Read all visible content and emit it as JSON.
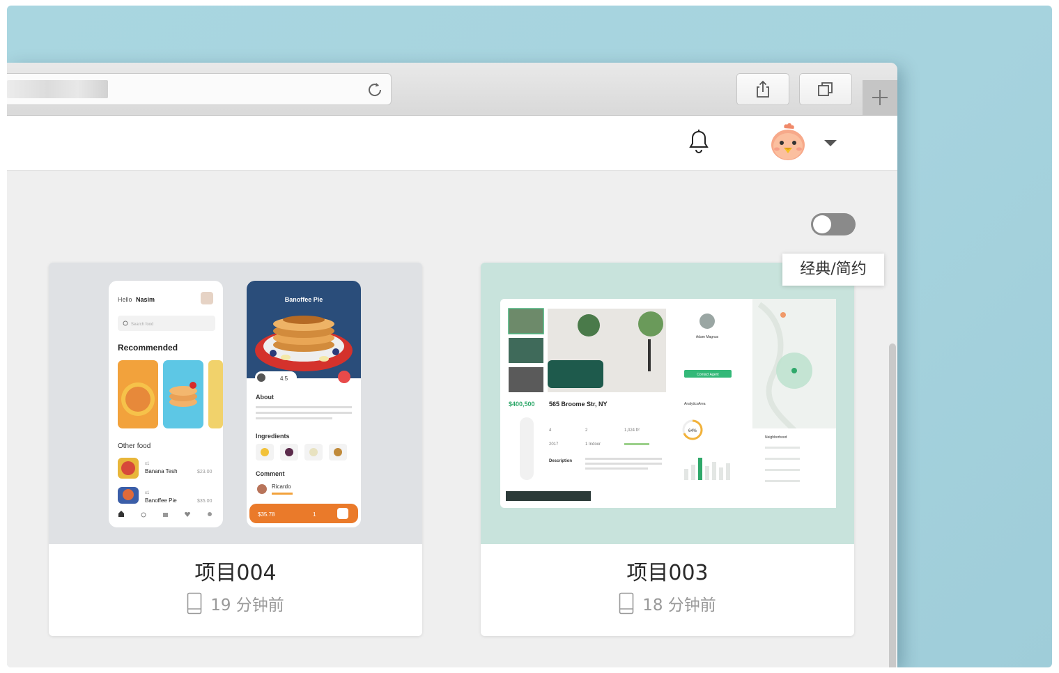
{
  "header": {
    "toggle_state": "off",
    "tooltip": "经典/简约"
  },
  "projects": [
    {
      "name": "项目004",
      "time": "19 分钟前",
      "preview": {
        "left_screen": {
          "greeting_prefix": "Hello",
          "greeting_name": "Nasim",
          "search_placeholder": "Search food",
          "section_recommended": "Recommended",
          "section_other": "Other food",
          "items": [
            {
              "qty": "x1",
              "name": "Banana Tesh",
              "price": "$23.00"
            },
            {
              "qty": "x1",
              "name": "Banoffee Pie",
              "price": "$35.00"
            }
          ]
        },
        "right_screen": {
          "title": "Banoffee Pie",
          "rating": "4.5",
          "about": "About",
          "ingredients": "Ingredients",
          "comment": "Comment",
          "commenter": "Ricardo",
          "price": "$35.78",
          "qty": "1"
        }
      }
    },
    {
      "name": "项目003",
      "time": "18 分钟前",
      "preview": {
        "price": "$400,500",
        "address": "565 Broome Str, NY",
        "agent": "Adam Magnus",
        "contact": "Contact Agent",
        "analytics": "AnalyticsArea",
        "percent": "64%",
        "neighborhood": "Neighborhood",
        "description": "Description",
        "year": "2017",
        "stats": [
          "4",
          "2",
          "1,024 ft²",
          "1 Indoor"
        ]
      }
    }
  ]
}
